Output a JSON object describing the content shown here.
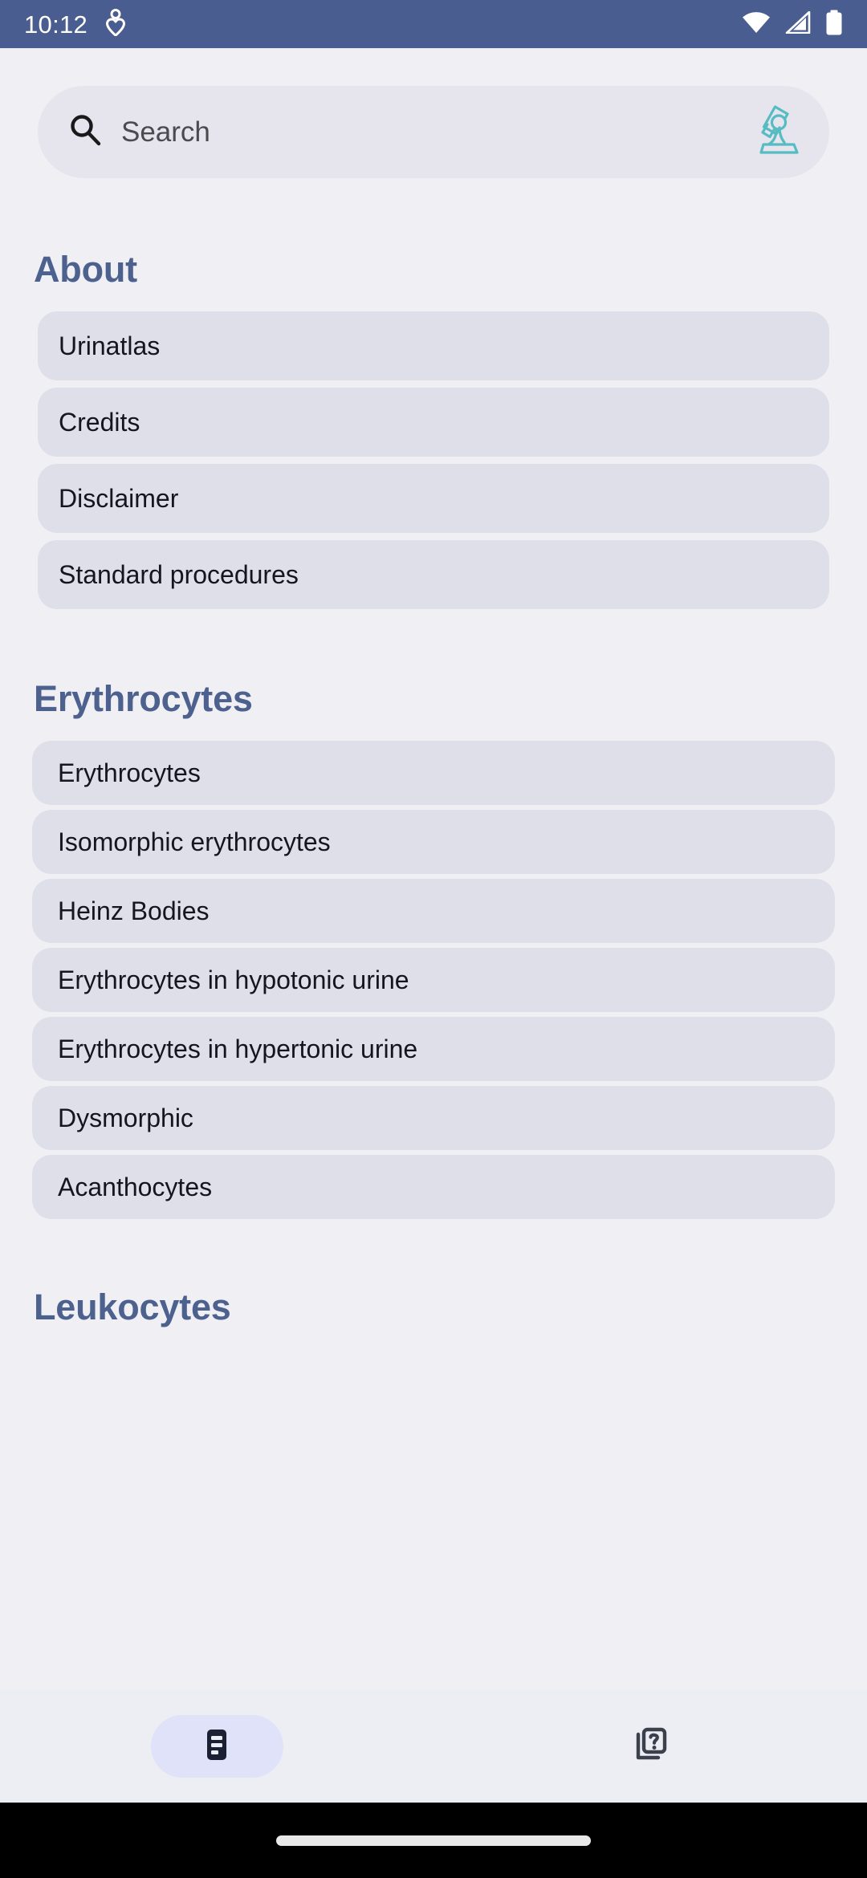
{
  "statusbar": {
    "time": "10:12",
    "icons": [
      "heart-health-icon",
      "wifi-icon",
      "cellular-signal-icon",
      "battery-icon"
    ],
    "background_color": "#4a5d90",
    "foreground_color": "#ffffff"
  },
  "search": {
    "placeholder": "Search",
    "value": "",
    "leading_icon": "search-icon",
    "trailing_icon": "microscope-icon",
    "trailing_icon_color": "#57bcc2",
    "background_color": "#e6e5ee"
  },
  "theme": {
    "page_background": "#f0eff4",
    "card_background": "#dedfe9",
    "section_header_color": "#4d618f",
    "card_text_color": "#15161d",
    "nav_background": "#eceef4",
    "nav_active_pill": "#dfe2f9",
    "nav_icon_color": "#1c2033"
  },
  "sections": [
    {
      "title": "About",
      "items": [
        {
          "label": "Urinatlas"
        },
        {
          "label": "Credits"
        },
        {
          "label": "Disclaimer"
        },
        {
          "label": "Standard procedures"
        }
      ]
    },
    {
      "title": "Erythrocytes",
      "items": [
        {
          "label": "Erythrocytes"
        },
        {
          "label": "Isomorphic erythrocytes"
        },
        {
          "label": "Heinz Bodies"
        },
        {
          "label": "Erythrocytes in hypotonic urine"
        },
        {
          "label": "Erythrocytes in hypertonic urine"
        },
        {
          "label": "Dysmorphic"
        },
        {
          "label": "Acanthocytes"
        }
      ]
    },
    {
      "title": "Leukocytes",
      "items": []
    }
  ],
  "bottom_nav": {
    "items": [
      {
        "name": "atlas",
        "icon": "article-list-icon",
        "selected": true
      },
      {
        "name": "quiz",
        "icon": "quiz-cards-icon",
        "selected": false
      }
    ]
  }
}
